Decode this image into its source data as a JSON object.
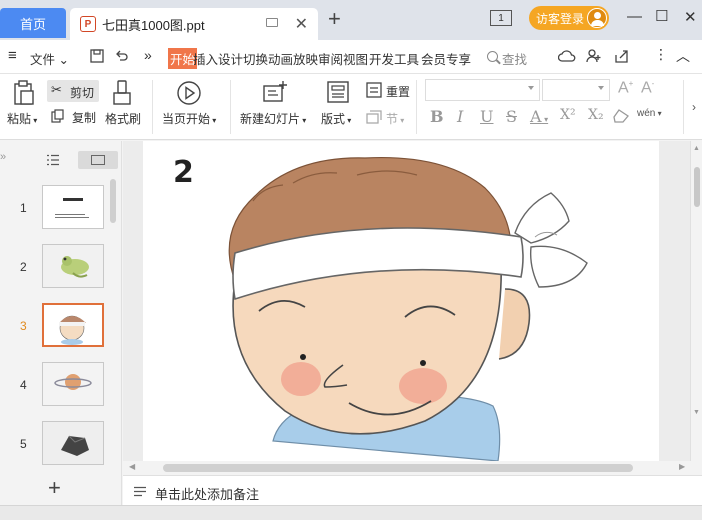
{
  "titlebar": {
    "home_tab": "首页",
    "doc_tab": "七田真1000图.ppt",
    "add_tab": "+",
    "num_icon": "1",
    "visitor_login": "访客登录",
    "min": "—",
    "max": "☐",
    "close": "✕"
  },
  "menubar": {
    "file": "文件",
    "more": "»",
    "items": [
      "开始",
      "插入",
      "设计",
      "切换",
      "动画",
      "放映",
      "审阅",
      "视图",
      "开发工具",
      "会员专享"
    ],
    "search": "查找"
  },
  "ribbon": {
    "paste": "粘贴",
    "cut": "剪切",
    "copy": "复制",
    "format_painter": "格式刷",
    "play_from_current": "当页开始",
    "new_slide": "新建幻灯片",
    "layout": "版式",
    "reset": "重置",
    "section": "节",
    "font_size_up": "A",
    "font_size_down": "A",
    "bold": "B",
    "italic": "I",
    "underline": "U",
    "strikethrough": "S",
    "font_color": "A",
    "superscript": "X²",
    "subscript": "X₂",
    "pinyin": "wén"
  },
  "slides": {
    "thumbnails": [
      {
        "num": "1"
      },
      {
        "num": "2"
      },
      {
        "num": "3",
        "active": true
      },
      {
        "num": "4"
      },
      {
        "num": "5"
      }
    ],
    "add_slide": "+"
  },
  "canvas": {
    "slide_number": "2"
  },
  "notes": {
    "placeholder": "单击此处添加备注"
  },
  "colors": {
    "accent": "#4c8af2",
    "active_menu": "#f0764a",
    "visitor_badge": "#f5a623",
    "active_thumb_border": "#e0703a"
  }
}
